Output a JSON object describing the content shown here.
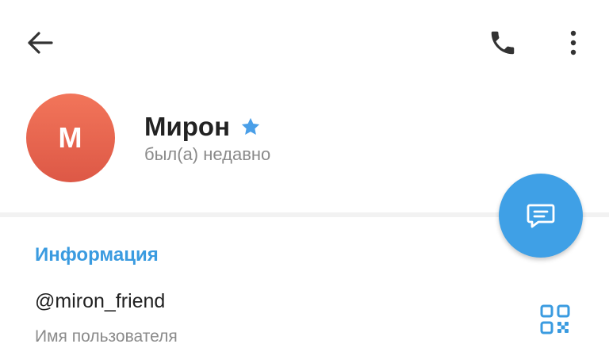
{
  "header": {
    "back_icon": "arrow-left-icon",
    "call_icon": "phone-icon",
    "more_icon": "more-vertical-icon"
  },
  "profile": {
    "avatar_letter": "M",
    "avatar_color": "#e8634f",
    "name": "Мирон",
    "badge_icon": "star-icon",
    "badge_color": "#4a9fe8",
    "status": "был(а) недавно"
  },
  "fab": {
    "icon": "message-icon",
    "color": "#3fa0e6"
  },
  "info": {
    "section_title": "Информация",
    "username": "@miron_friend",
    "username_caption": "Имя пользователя",
    "qr_icon": "qr-code-icon"
  },
  "colors": {
    "accent": "#3a9be0",
    "text_primary": "#222222",
    "text_secondary": "#8a8a8a"
  }
}
